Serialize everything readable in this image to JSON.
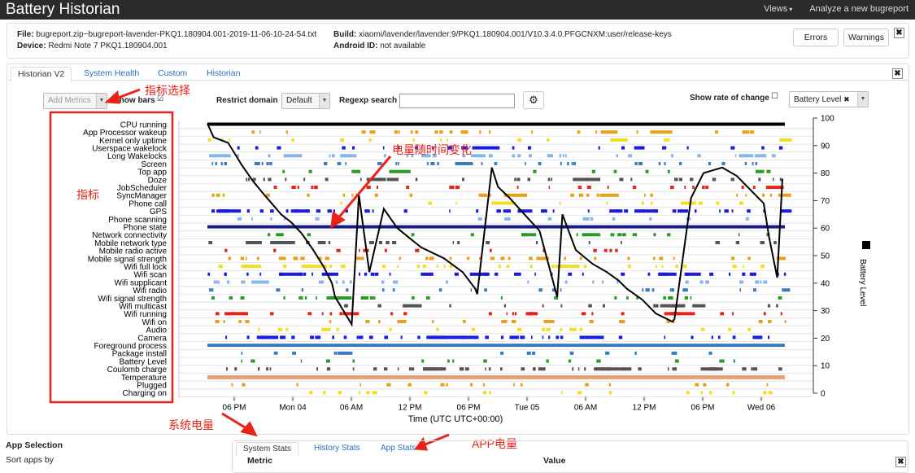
{
  "app": {
    "title": "Battery Historian",
    "nav": [
      "Views",
      "Analyze a new bugreport"
    ]
  },
  "file_info": {
    "file_label": "File:",
    "file_value": "bugreport.zip~bugreport-lavender-PKQ1.180904.001-2019-11-06-10-24-54.txt",
    "device_label": "Device:",
    "device_value": "Redmi Note 7 PKQ1.180904.001",
    "build_label": "Build:",
    "build_value": "xiaomi/lavender/lavender:9/PKQ1.180904.001/V10.3.4.0.PFGCNXM:user/release-keys",
    "android_id_label": "Android ID:",
    "android_id_value": "not available",
    "buttons": [
      "Errors",
      "Warnings"
    ],
    "close": "✖"
  },
  "tabs": [
    "Historian V2",
    "System Health",
    "Custom",
    "Historian"
  ],
  "controls": {
    "add_metrics": "Add Metrics",
    "show_bars": "Show bars",
    "restrict_domain": "Restrict domain",
    "domain_value": "Default",
    "regexp": "Regexp search",
    "show_rate": "Show rate of change",
    "battery_select": "Battery Level"
  },
  "chart_data": {
    "type": "line",
    "metrics": [
      "CPU running",
      "App Processor wakeup",
      "Kernel only uptime",
      "Userspace wakelock",
      "Long Wakelocks",
      "Screen",
      "Top app",
      "Doze",
      "JobScheduler",
      "SyncManager",
      "Phone call",
      "GPS",
      "Phone scanning",
      "Phone state",
      "Network connectivity",
      "Mobile network type",
      "Mobile radio active",
      "Mobile signal strength",
      "Wifi full lock",
      "Wifi scan",
      "Wifi supplicant",
      "Wifi radio",
      "Wifi signal strength",
      "Wifi multicast",
      "Wifi running",
      "Wifi on",
      "Audio",
      "Camera",
      "Foreground process",
      "Package install",
      "Battery Level",
      "Coulomb charge",
      "Temperature",
      "Plugged",
      "Charging on"
    ],
    "x_ticks": [
      "06 PM",
      "Mon 04",
      "06 AM",
      "12 PM",
      "06 PM",
      "Tue 05",
      "06 AM",
      "12 PM",
      "06 PM",
      "Wed 06"
    ],
    "y_ticks": [
      100,
      90,
      80,
      70,
      60,
      50,
      40,
      30,
      20,
      10,
      0
    ],
    "ylim": [
      0,
      100
    ],
    "xlabel": "Time (UTC UTC+00:00)",
    "ylabel": "Battery Level",
    "series": [
      {
        "name": "Battery Level",
        "x": [
          0,
          0.6,
          2,
          3.3,
          4.4,
          5.5,
          6.2,
          7.1,
          8.1,
          9.1,
          10.2,
          11.2,
          12,
          12.3,
          13.9,
          14.6,
          15.6,
          17,
          18.3,
          19.6,
          20.6,
          22.8,
          24.6,
          25.8,
          26,
          27.4,
          28,
          29.1,
          30.3,
          32,
          33.7,
          34.2,
          35.5,
          37.1,
          38.5,
          39.6,
          40.4,
          41.9,
          43.2,
          44.8,
          45,
          46.6,
          47.8,
          49.6,
          51,
          52.3,
          53.6,
          54.1,
          54.9,
          55.4
        ],
        "y": [
          98,
          93,
          91,
          83,
          77,
          72,
          69,
          65,
          62,
          58,
          52,
          46,
          40,
          35,
          25,
          72,
          44,
          67,
          60,
          56,
          53,
          49,
          44,
          38,
          36,
          82,
          75,
          71,
          66,
          59,
          35,
          65,
          52,
          47,
          44,
          41,
          38,
          34,
          29,
          26,
          27,
          71,
          80,
          82,
          79,
          74,
          69,
          57,
          42,
          78
        ]
      }
    ]
  },
  "annotations": {
    "metric_select": "指标选择",
    "metrics": "指标",
    "battery_over_time": "电量随时间变化",
    "system_power": "系统电量",
    "app_power": "APP电量"
  },
  "bottom": {
    "app_selection": "App Selection",
    "sort_apps": "Sort apps by",
    "stat_tabs": [
      "System Stats",
      "History Stats",
      "App Stats"
    ],
    "metric_col": "Metric",
    "value_col": "Value"
  }
}
